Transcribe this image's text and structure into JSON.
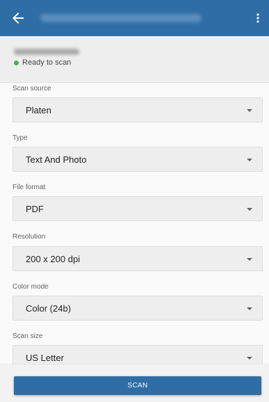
{
  "app_bar": {
    "back_icon": "arrow-back-icon",
    "more_icon": "more-vert-icon",
    "color": "#2f6ea5"
  },
  "device": {
    "status": "Ready to scan",
    "status_color": "#4caf50"
  },
  "fields": {
    "scan_source": {
      "label": "Scan source",
      "value": "Platen"
    },
    "type": {
      "label": "Type",
      "value": "Text And Photo"
    },
    "file_format": {
      "label": "File format",
      "value": "PDF"
    },
    "resolution": {
      "label": "Resolution",
      "value": "200 x 200 dpi"
    },
    "color_mode": {
      "label": "Color mode",
      "value": "Color (24b)"
    },
    "scan_size": {
      "label": "Scan size",
      "value": "US Letter"
    }
  },
  "actions": {
    "scan_label": "SCAN"
  }
}
